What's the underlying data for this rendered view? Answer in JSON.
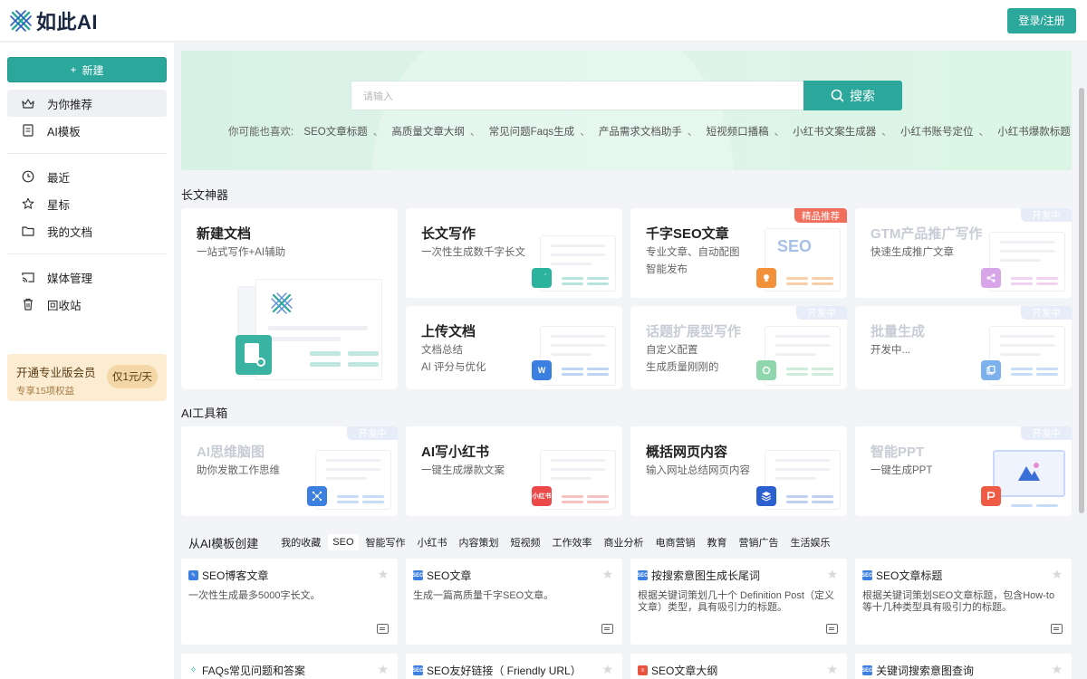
{
  "header": {
    "logo_text": "如此AI",
    "login_label": "登录/注册",
    "brand_color": "#2ba89b"
  },
  "sidebar": {
    "new_label": "新建",
    "items_top": [
      {
        "label": "为你推荐",
        "icon": "crown-icon",
        "active": true
      },
      {
        "label": "AI模板",
        "icon": "document-icon",
        "active": false
      }
    ],
    "items_mid": [
      {
        "label": "最近",
        "icon": "clock-icon"
      },
      {
        "label": "星标",
        "icon": "star-icon"
      },
      {
        "label": "我的文档",
        "icon": "folder-icon"
      }
    ],
    "items_bottom": [
      {
        "label": "媒体管理",
        "icon": "cast-icon"
      },
      {
        "label": "回收站",
        "icon": "trash-icon"
      }
    ],
    "vip": {
      "title": "开通专业版会员",
      "subtitle": "专享15项权益",
      "badge": "仅1元/天"
    }
  },
  "hero": {
    "search_placeholder": "请输入",
    "search_button": "搜索",
    "suggest_prefix": "你可能也喜欢:",
    "suggestions": [
      "SEO文章标题",
      "高质量文章大纲",
      "常见问题Faqs生成",
      "产品需求文档助手",
      "短视频口播稿",
      "小红书文案生成器",
      "小红书账号定位",
      "小红书爆款标题"
    ]
  },
  "longform": {
    "section_title": "长文神器",
    "new_doc": {
      "title": "新建文档",
      "desc": "一站式写作+AI辅助"
    },
    "cards": [
      {
        "title": "长文写作",
        "desc1": "一次性生成数千字长文",
        "desc2": "",
        "badge": "",
        "icon_label": "",
        "dim": false
      },
      {
        "title": "千字SEO文章",
        "desc1": "专业文章、自动配图",
        "desc2": "智能发布",
        "badge": "精品推荐",
        "icon_label": "SEO",
        "dim": false
      },
      {
        "title": "GTM产品推广写作",
        "desc1": "快速生成推广文章",
        "desc2": "",
        "badge": "开发中",
        "icon_label": "",
        "dim": true
      },
      {
        "title": "上传文档",
        "desc1": "文档总结",
        "desc2": "AI 评分与优化",
        "badge": "",
        "icon_label": "W",
        "dim": false
      },
      {
        "title": "话题扩展型写作",
        "desc1": "自定义配置",
        "desc2": "生成质量刚刚的",
        "badge": "开发中",
        "icon_label": "",
        "dim": true
      },
      {
        "title": "批量生成",
        "desc1": "开发中...",
        "desc2": "",
        "badge": "开发中",
        "icon_label": "",
        "dim": true
      }
    ]
  },
  "toolbox": {
    "section_title": "AI工具箱",
    "cards": [
      {
        "title": "AI思维脑图",
        "desc": "助你发散工作思维",
        "badge": "开发中",
        "icon_label": "",
        "dim": true
      },
      {
        "title": "AI写小红书",
        "desc": "一键生成爆款文案",
        "badge": "",
        "icon_label": "小红书",
        "dim": false
      },
      {
        "title": "概括网页内容",
        "desc": "输入网址总结网页内容",
        "badge": "",
        "icon_label": "",
        "dim": false
      },
      {
        "title": "智能PPT",
        "desc": "一键生成PPT",
        "badge": "开发中",
        "icon_label": "",
        "dim": true
      }
    ]
  },
  "templates": {
    "title": "从AI模板创建",
    "tabs": [
      "我的收藏",
      "SEO",
      "智能写作",
      "小红书",
      "内容策划",
      "短视频",
      "工作效率",
      "商业分析",
      "电商营销",
      "教育",
      "营销广告",
      "生活娱乐"
    ],
    "active_tab": "SEO",
    "row1": [
      {
        "name": "SEO博客文章",
        "desc": "一次性生成最多5000字长文。",
        "icon": "edit-icon"
      },
      {
        "name": "SEO文章",
        "desc": "生成一篇高质量千字SEO文章。",
        "icon": "seo-icon"
      },
      {
        "name": "按搜索意图生成长尾词",
        "desc": "根据关键词策划几十个 Definition Post（定义文章）类型，具有吸引力的标题。",
        "icon": "seo-icon"
      },
      {
        "name": "SEO文章标题",
        "desc": "根据关键词策划SEO文章标题，包含How-to等十几种类型具有吸引力的标题。",
        "icon": "seo-icon"
      }
    ],
    "row2": [
      {
        "name": "FAQs常见问题和答案",
        "icon": "bulb-icon"
      },
      {
        "name": "SEO友好链接（ Friendly URL）",
        "icon": "seo-icon"
      },
      {
        "name": "SEO文章大纲",
        "icon": "outline-icon"
      },
      {
        "name": "关键词搜索意图查询",
        "icon": "seo-icon"
      }
    ]
  }
}
